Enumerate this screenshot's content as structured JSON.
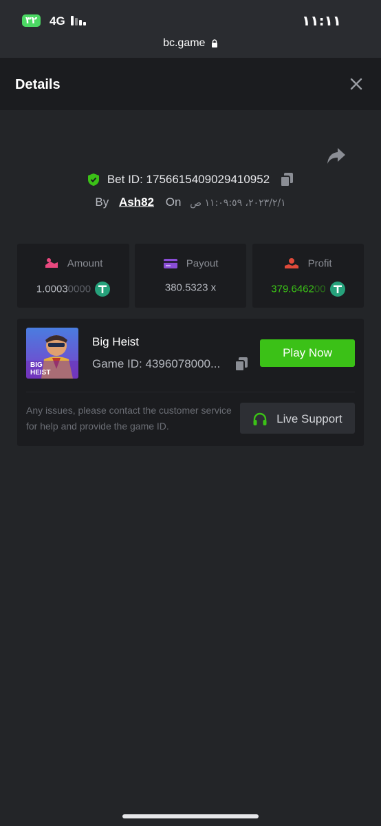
{
  "status_bar": {
    "battery": "٣٢",
    "network": "4G",
    "time": "١١:١١"
  },
  "browser": {
    "url": "bc.game"
  },
  "header": {
    "title": "Details"
  },
  "bet": {
    "id_label": "Bet ID:",
    "id": "1756615409029410952",
    "by_label": "By",
    "user": "Ash82",
    "on_label": "On",
    "date": "٢٠٢٣/٢/١، ١١:٠٩:٥٩ ص"
  },
  "stats": {
    "amount": {
      "label": "Amount",
      "value_main": "1.0003",
      "value_dim": "0000"
    },
    "payout": {
      "label": "Payout",
      "value": "380.5323 x"
    },
    "profit": {
      "label": "Profit",
      "value_main": "379.6462",
      "value_dim": "00"
    }
  },
  "game": {
    "name": "Big Heist",
    "id_text": "Game ID: 4396078000...",
    "thumb_text_1": "BIG",
    "thumb_text_2": "HEIST",
    "play_label": "Play Now",
    "help_text": "Any issues, please contact the customer service for help and provide the game ID.",
    "support_label": "Live Support"
  },
  "colors": {
    "accent_green": "#3bc117",
    "background": "#232528",
    "card": "#1b1c1f"
  }
}
